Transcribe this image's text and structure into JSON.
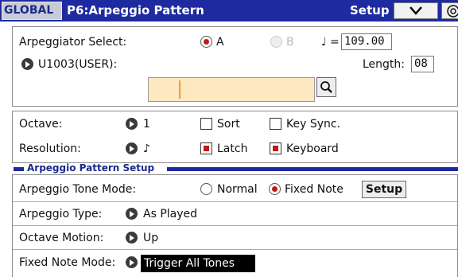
{
  "header": {
    "mode_tab": "GLOBAL",
    "page_title": "P6:Arpeggio Pattern",
    "setup_label": "Setup"
  },
  "arp_select": {
    "label": "Arpeggiator Select:",
    "option_a": "A",
    "option_b": "B",
    "tempo_symbol": "♩ =",
    "tempo_value": "109.00",
    "pattern_name": "U1003(USER):",
    "length_label": "Length:",
    "length_value": "08",
    "search_text": ""
  },
  "params": {
    "octave_label": "Octave:",
    "octave_value": "1",
    "sort_label": "Sort",
    "key_sync_label": "Key Sync.",
    "resolution_label": "Resolution:",
    "resolution_value": "♪",
    "latch_label": "Latch",
    "keyboard_label": "Keyboard"
  },
  "pattern_setup": {
    "section_title": "Arpeggio Pattern Setup",
    "tone_mode_label": "Arpeggio Tone Mode:",
    "normal_label": "Normal",
    "fixed_note_label": "Fixed Note",
    "setup_button": "Setup",
    "type_label": "Arpeggio Type:",
    "type_value": "As Played",
    "octave_motion_label": "Octave Motion:",
    "octave_motion_value": "Up",
    "fixed_note_mode_label": "Fixed Note Mode:",
    "fixed_note_mode_value": "Trigger All Tones"
  },
  "colors": {
    "title_bar": "#1e2aa0",
    "accent_red": "#c01818",
    "search_field": "#fde8c2"
  }
}
